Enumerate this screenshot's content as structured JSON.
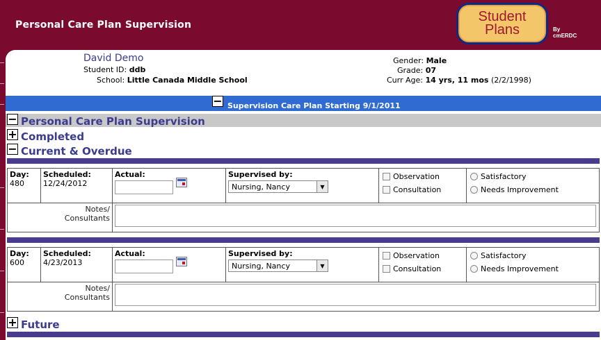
{
  "header": {
    "title": "Personal Care Plan Supervision"
  },
  "logo": {
    "line1": "Student",
    "line2": "Plans",
    "by_line1": "By",
    "by_line2": "cmERDC"
  },
  "student": {
    "name": "David Demo",
    "id_label": "Student ID:",
    "id_value": "ddb",
    "school_label": "School:",
    "school_value": "Little Canada Middle School",
    "gender_label": "Gender:",
    "gender_value": "Male",
    "grade_label": "Grade:",
    "grade_value": "07",
    "age_label": "Curr Age:",
    "age_value": "14 yrs, 11 mos",
    "dob": "(2/2/1998)"
  },
  "plan_bar": {
    "toggle": "−",
    "title": "Supervision Care Plan Starting 9/1/2011"
  },
  "sections": {
    "supervision": {
      "toggle": "−",
      "title": "Personal Care Plan Supervision"
    },
    "completed": {
      "toggle": "+",
      "title": "Completed"
    },
    "current": {
      "toggle": "−",
      "title": "Current & Overdue"
    },
    "future": {
      "toggle": "+",
      "title": "Future"
    }
  },
  "labels": {
    "day": "Day:",
    "scheduled": "Scheduled:",
    "actual": "Actual:",
    "supervised_by": "Supervised by:",
    "observation": "Observation",
    "consultation": "Consultation",
    "satisfactory": "Satisfactory",
    "needs_improvement": "Needs Improvement",
    "notes_line1": "Notes/",
    "notes_line2": "Consultants"
  },
  "entries": [
    {
      "day": "480",
      "scheduled": "12/24/2012",
      "actual": "",
      "supervisor": "Nursing, Nancy"
    },
    {
      "day": "600",
      "scheduled": "4/23/2013",
      "actual": "",
      "supervisor": "Nursing, Nancy"
    }
  ],
  "colors": {
    "maroon": "#7a0a2e",
    "blue_bar": "#2f6bd1",
    "purple_bar": "#4a3c8c",
    "section_text": "#3b3b8f"
  },
  "icons": {
    "calendar": "calendar-icon",
    "dropdown": "chevron-down-icon",
    "collapse": "minus-icon",
    "expand": "plus-icon"
  }
}
